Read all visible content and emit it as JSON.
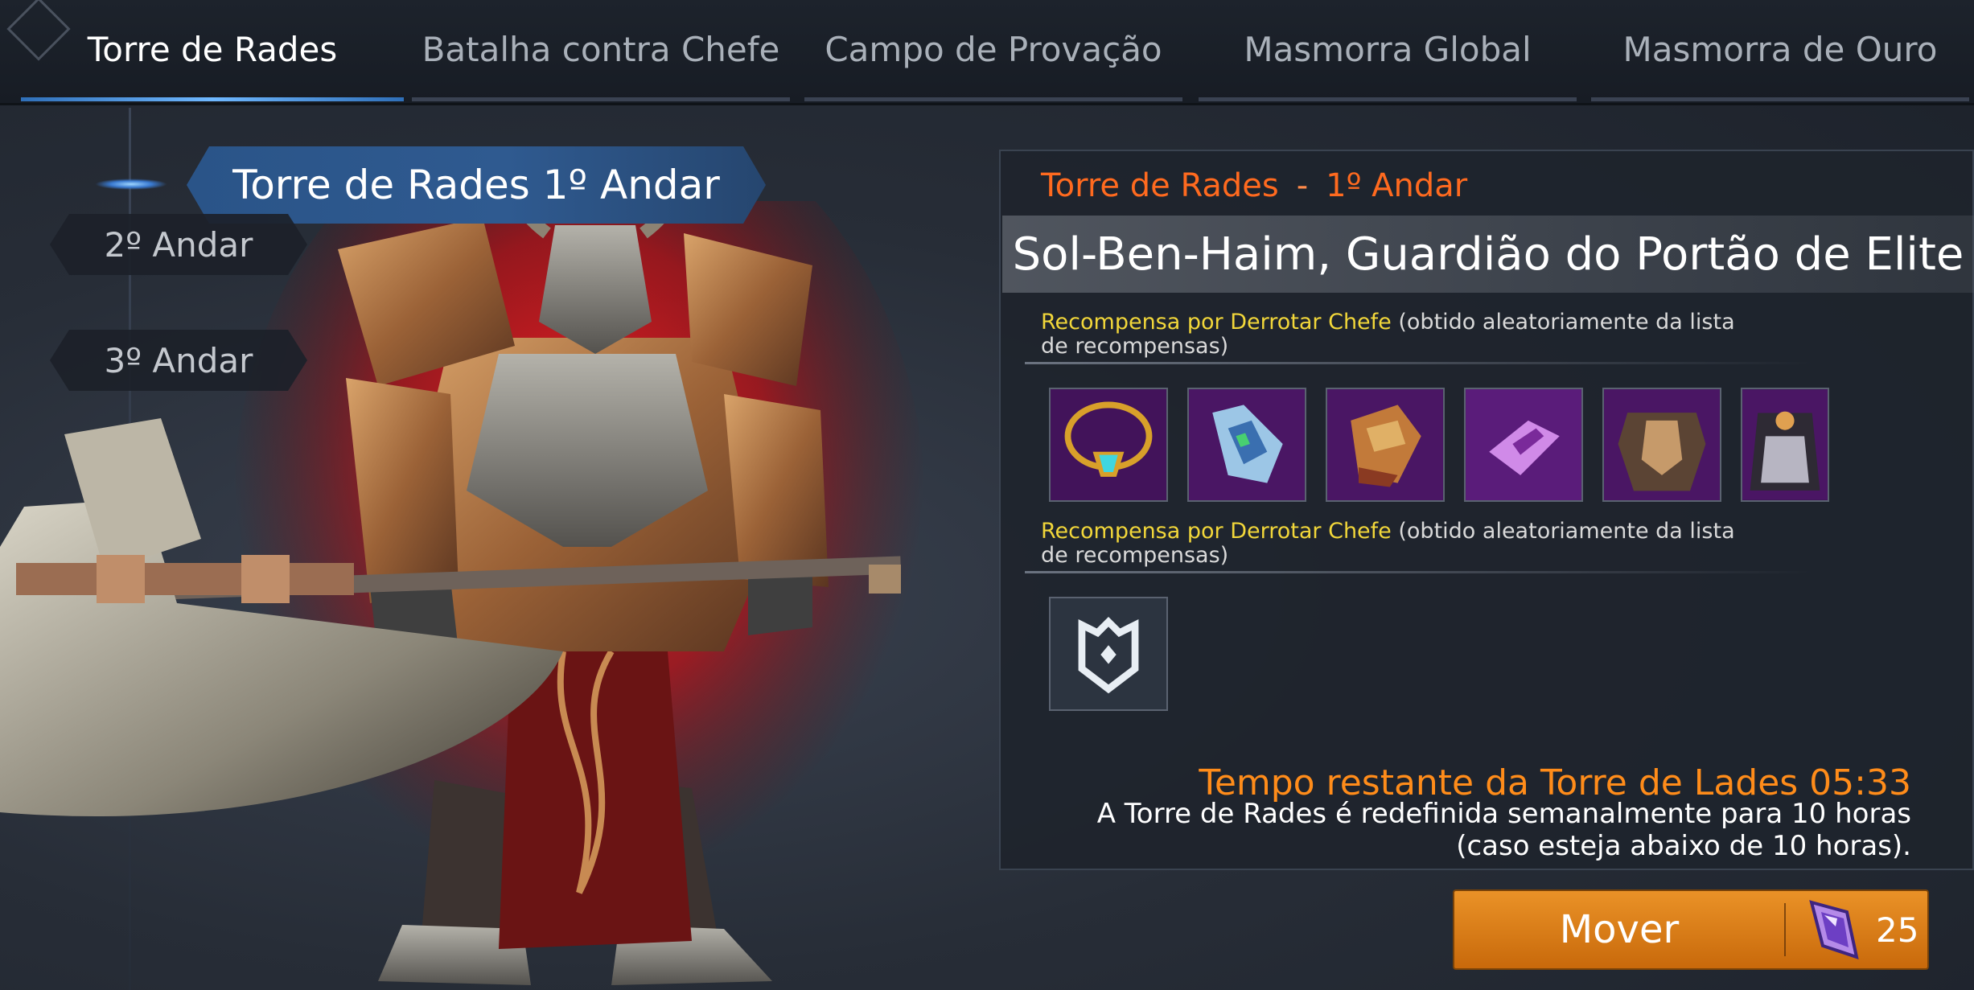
{
  "tabs": [
    {
      "label": "Torre de Rades",
      "active": true
    },
    {
      "label": "Batalha contra Chefe",
      "active": false
    },
    {
      "label": "Campo de Provação",
      "active": false
    },
    {
      "label": "Masmorra Global",
      "active": false
    },
    {
      "label": "Masmorra de Ouro",
      "active": false
    }
  ],
  "floors": {
    "current": "Torre de Rades 1º Andar",
    "items": [
      "2º Andar",
      "3º Andar"
    ]
  },
  "panel": {
    "tower": "Torre de Rades",
    "separator": "-",
    "floor": "1º Andar",
    "boss_name": "Sol-Ben-Haim, Guardião do Portão de Elite",
    "reward1": {
      "highlight": "Recompensa por Derrotar Chefe",
      "rest": " (obtido aleatoriamente da lista de recompensas)"
    },
    "reward2": {
      "highlight": "Recompensa por Derrotar Chefe",
      "rest": " (obtido aleatoriamente da lista de recompensas)"
    },
    "reward_icons_1": [
      "necklace-icon",
      "gauntlet-icon",
      "glove-icon",
      "bracer-icon",
      "armor-icon",
      "cloak-icon"
    ],
    "reward_icons_2": [
      "emblem-icon"
    ],
    "timer": "Tempo restante da Torre de Lades 05:33",
    "note": "A Torre de Rades é redefinida semanalmente para 10 horas (caso esteja abaixo de 10 horas)."
  },
  "move_button": {
    "label": "Mover",
    "cost": "25",
    "cost_icon": "crystal-icon"
  },
  "colors": {
    "accent_orange": "#ff6a1f",
    "highlight_yellow": "#f2d73a",
    "timer_orange": "#ff8c1a",
    "tab_active": "#6fb8ff"
  }
}
